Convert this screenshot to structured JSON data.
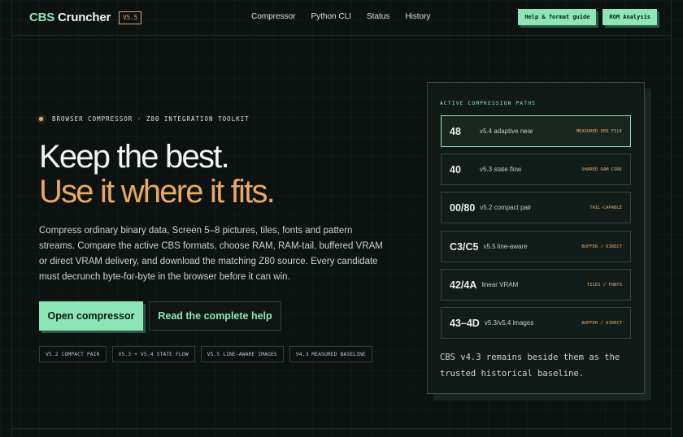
{
  "header": {
    "brand_accent": "CBS",
    "brand_rest": " Cruncher",
    "version": "V5.5",
    "nav": [
      "Compressor",
      "Python CLI",
      "Status",
      "History"
    ],
    "buttons": [
      "Help & format guide",
      "ROM Analysis"
    ]
  },
  "hero": {
    "eyebrow": "BROWSER COMPRESSOR · Z80 INTEGRATION TOOLKIT",
    "headline_1": "Keep the best.",
    "headline_2": "Use it where it fits.",
    "lede": "Compress ordinary binary data, Screen 5–8 pictures, tiles, fonts and pattern streams. Compare the active CBS formats, choose RAM, RAM-tail, buffered VRAM or direct VRAM delivery, and download the matching Z80 source. Every candidate must decrunch byte-for-byte in the browser before it can win.",
    "cta_primary": "Open compressor",
    "cta_secondary": "Read the complete help",
    "tags": [
      "V5.2 COMPACT PAIR",
      "V5.3 + V5.4 STATE FLOW",
      "V5.5 LINE-AWARE IMAGES",
      "V4.3 MEASURED BASELINE"
    ]
  },
  "panel": {
    "label": "ACTIVE COMPRESSION PATHS",
    "paths": [
      {
        "num": "48",
        "desc": "v5.4 adaptive near",
        "tag": "MEASURED PER FILE",
        "active": true
      },
      {
        "num": "40",
        "desc": "v5.3 state flow",
        "tag": "SHARED RAM CORE",
        "active": false
      },
      {
        "num": "00/80",
        "desc": "v5.2 compact pair",
        "tag": "TAIL-CAPABLE",
        "active": false
      },
      {
        "num": "C3/C5",
        "desc": "v5.5 line-aware",
        "tag": "BUFFER / DIRECT",
        "active": false
      },
      {
        "num": "42/4A",
        "desc": "linear VRAM",
        "tag": "TILES / FONTS",
        "active": false
      },
      {
        "num": "43–4D",
        "desc": "v5.3/v5.4 images",
        "tag": "BUFFER / DIRECT",
        "active": false
      }
    ],
    "footnote": "CBS v4.3 remains beside them as the trusted historical baseline."
  },
  "colors": {
    "accent": "#8de6b5",
    "warm": "#e9a961",
    "background": "#0c1210"
  }
}
